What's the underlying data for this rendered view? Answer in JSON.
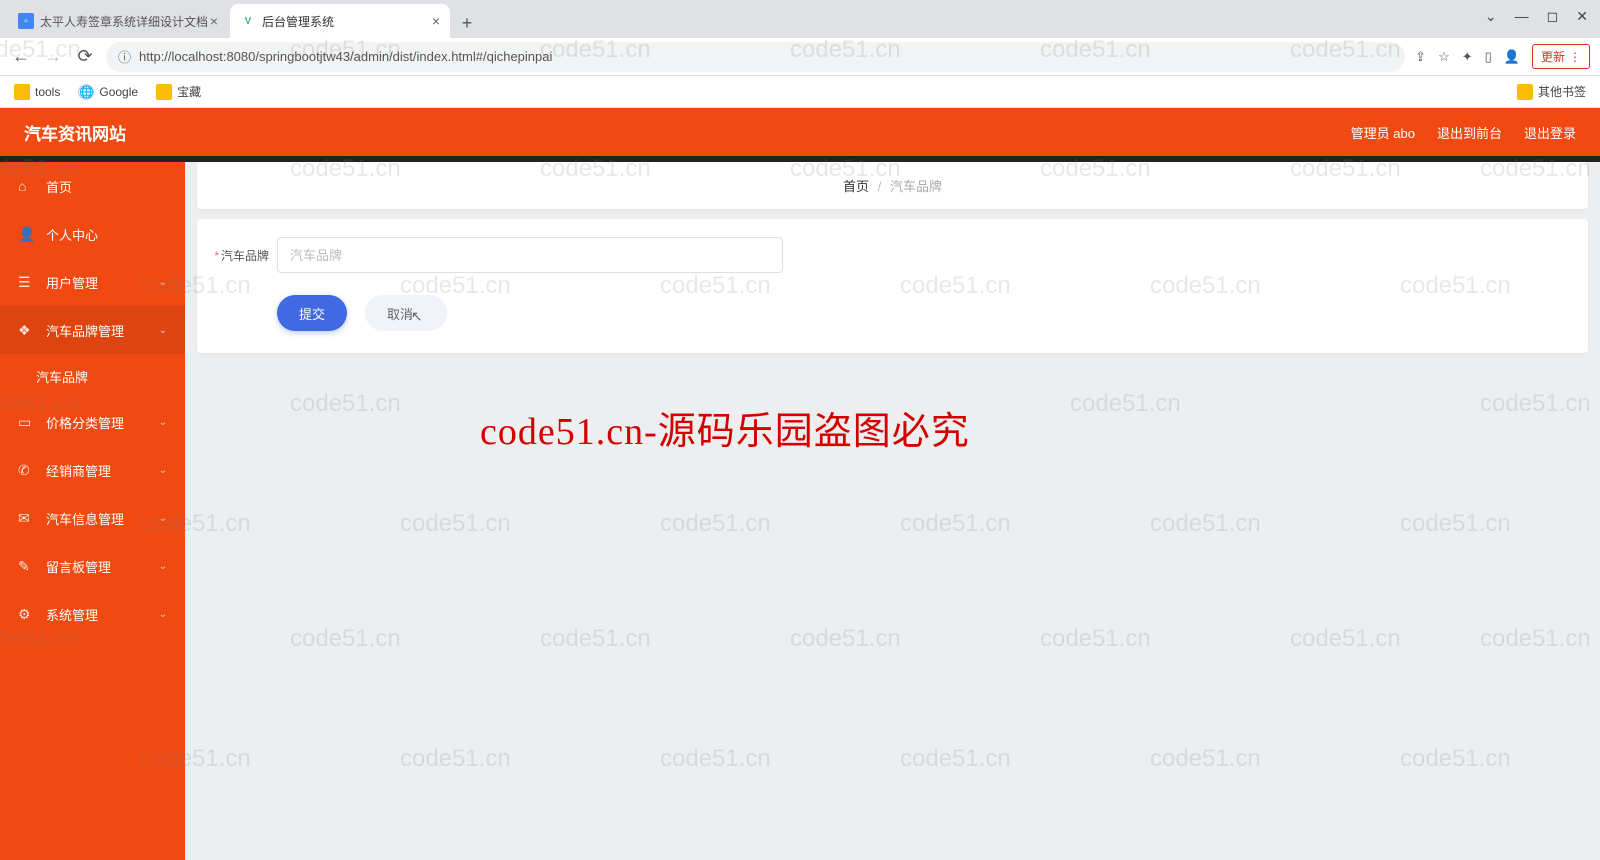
{
  "browser": {
    "tabs": [
      {
        "title": "太平人寿签章系统详细设计文档",
        "favicon_bg": "#4285f4"
      },
      {
        "title": "后台管理系统",
        "favicon_bg": "#41b883"
      }
    ],
    "url": "http://localhost:8080/springbootjtw43/admin/dist/index.html#/qichepinpai",
    "url_host": "localhost",
    "bookmarks": [
      {
        "label": "tools",
        "color": "#fbbc04"
      },
      {
        "label": "Google",
        "color": "#777"
      },
      {
        "label": "宝藏",
        "color": "#fbbc04"
      }
    ],
    "other_bookmarks": "其他书签",
    "update_btn": "更新"
  },
  "header": {
    "brand": "汽车资讯网站",
    "user": "管理员 abo",
    "exit_front": "退出到前台",
    "logout": "退出登录"
  },
  "sidebar": {
    "items": [
      {
        "icon": "⌂",
        "label": "首页"
      },
      {
        "icon": "👤",
        "label": "个人中心"
      },
      {
        "icon": "☰",
        "label": "用户管理",
        "expandable": true
      },
      {
        "icon": "❖",
        "label": "汽车品牌管理",
        "expandable": true,
        "open": true,
        "children": [
          "汽车品牌"
        ]
      },
      {
        "icon": "▭",
        "label": "价格分类管理",
        "expandable": true
      },
      {
        "icon": "✆",
        "label": "经销商管理",
        "expandable": true
      },
      {
        "icon": "✉",
        "label": "汽车信息管理",
        "expandable": true
      },
      {
        "icon": "✎",
        "label": "留言板管理",
        "expandable": true
      },
      {
        "icon": "⚙",
        "label": "系统管理",
        "expandable": true
      }
    ]
  },
  "breadcrumb": {
    "home": "首页",
    "current": "汽车品牌"
  },
  "form": {
    "field_label": "汽车品牌",
    "placeholder": "汽车品牌",
    "submit": "提交",
    "cancel": "取消"
  },
  "watermark": {
    "small": "code51.cn",
    "big": "code51.cn-源码乐园盗图必究"
  }
}
